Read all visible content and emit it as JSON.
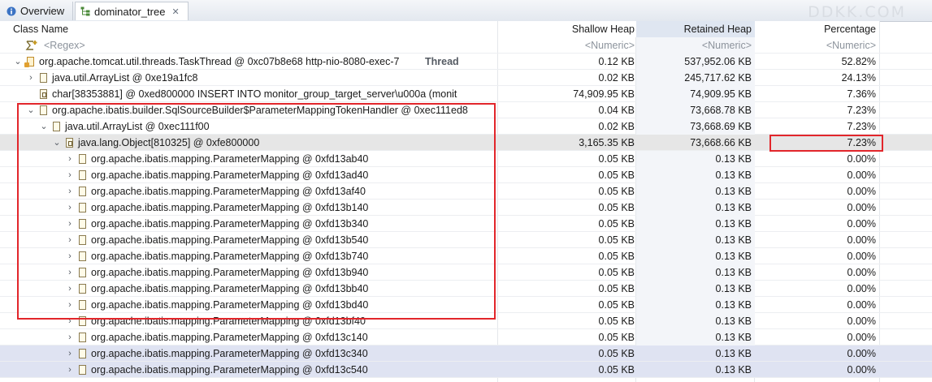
{
  "tabs": [
    {
      "label": "Overview",
      "icon": "info-icon"
    },
    {
      "label": "dominator_tree",
      "icon": "tree-icon",
      "close": "✕"
    }
  ],
  "watermark": "DDKK.COM",
  "columns": {
    "class_name": "Class Name",
    "shallow_heap": "Shallow Heap",
    "retained_heap": "Retained Heap",
    "percentage": "Percentage"
  },
  "filter": {
    "regex": "<Regex>",
    "shallow": "<Numeric>",
    "retained": "<Numeric>",
    "percentage": "<Numeric>"
  },
  "rows": [
    {
      "name": "org.apache.tomcat.util.threads.TaskThread @ 0xc07b8e68  http-nio-8080-exec-7",
      "suffix": "Thread",
      "shallow": "0.12 KB",
      "retained": "537,952.06 KB",
      "pct": "52.82%"
    },
    {
      "name": "java.util.ArrayList @ 0xe19a1fc8",
      "shallow": "0.02 KB",
      "retained": "245,717.62 KB",
      "pct": "24.13%"
    },
    {
      "name": "char[38353881] @ 0xed800000  INSERT INTO monitor_group_target_server\\u000a        (monit",
      "shallow": "74,909.95 KB",
      "retained": "74,909.95 KB",
      "pct": "7.36%"
    },
    {
      "name": "org.apache.ibatis.builder.SqlSourceBuilder$ParameterMappingTokenHandler @ 0xec111ed8",
      "shallow": "0.04 KB",
      "retained": "73,668.78 KB",
      "pct": "7.23%"
    },
    {
      "name": "java.util.ArrayList @ 0xec111f00",
      "shallow": "0.02 KB",
      "retained": "73,668.69 KB",
      "pct": "7.23%"
    },
    {
      "name": "java.lang.Object[810325] @ 0xfe800000",
      "shallow": "3,165.35 KB",
      "retained": "73,668.66 KB",
      "pct": "7.23%"
    },
    {
      "name": "org.apache.ibatis.mapping.ParameterMapping @ 0xfd13ab40",
      "shallow": "0.05 KB",
      "retained": "0.13 KB",
      "pct": "0.00%"
    },
    {
      "name": "org.apache.ibatis.mapping.ParameterMapping @ 0xfd13ad40",
      "shallow": "0.05 KB",
      "retained": "0.13 KB",
      "pct": "0.00%"
    },
    {
      "name": "org.apache.ibatis.mapping.ParameterMapping @ 0xfd13af40",
      "shallow": "0.05 KB",
      "retained": "0.13 KB",
      "pct": "0.00%"
    },
    {
      "name": "org.apache.ibatis.mapping.ParameterMapping @ 0xfd13b140",
      "shallow": "0.05 KB",
      "retained": "0.13 KB",
      "pct": "0.00%"
    },
    {
      "name": "org.apache.ibatis.mapping.ParameterMapping @ 0xfd13b340",
      "shallow": "0.05 KB",
      "retained": "0.13 KB",
      "pct": "0.00%"
    },
    {
      "name": "org.apache.ibatis.mapping.ParameterMapping @ 0xfd13b540",
      "shallow": "0.05 KB",
      "retained": "0.13 KB",
      "pct": "0.00%"
    },
    {
      "name": "org.apache.ibatis.mapping.ParameterMapping @ 0xfd13b740",
      "shallow": "0.05 KB",
      "retained": "0.13 KB",
      "pct": "0.00%"
    },
    {
      "name": "org.apache.ibatis.mapping.ParameterMapping @ 0xfd13b940",
      "shallow": "0.05 KB",
      "retained": "0.13 KB",
      "pct": "0.00%"
    },
    {
      "name": "org.apache.ibatis.mapping.ParameterMapping @ 0xfd13bb40",
      "shallow": "0.05 KB",
      "retained": "0.13 KB",
      "pct": "0.00%"
    },
    {
      "name": "org.apache.ibatis.mapping.ParameterMapping @ 0xfd13bd40",
      "shallow": "0.05 KB",
      "retained": "0.13 KB",
      "pct": "0.00%"
    },
    {
      "name": "org.apache.ibatis.mapping.ParameterMapping @ 0xfd13bf40",
      "shallow": "0.05 KB",
      "retained": "0.13 KB",
      "pct": "0.00%"
    },
    {
      "name": "org.apache.ibatis.mapping.ParameterMapping @ 0xfd13c140",
      "shallow": "0.05 KB",
      "retained": "0.13 KB",
      "pct": "0.00%"
    },
    {
      "name": "org.apache.ibatis.mapping.ParameterMapping @ 0xfd13c340",
      "shallow": "0.05 KB",
      "retained": "0.13 KB",
      "pct": "0.00%"
    },
    {
      "name": "org.apache.ibatis.mapping.ParameterMapping @ 0xfd13c540",
      "shallow": "0.05 KB",
      "retained": "0.13 KB",
      "pct": "0.00%"
    }
  ],
  "colors": {
    "highlight_border": "#e2262b",
    "selected_row": "#e6e6e6"
  }
}
